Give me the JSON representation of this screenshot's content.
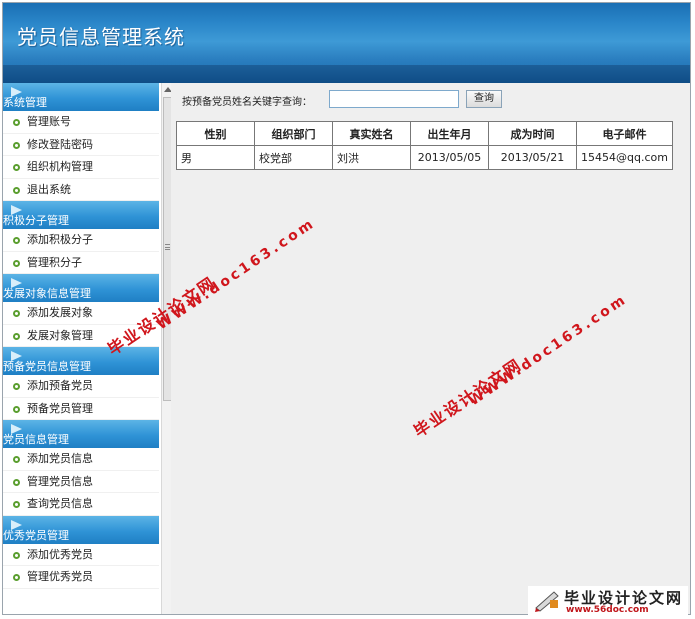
{
  "header": {
    "title": "党员信息管理系统"
  },
  "sidebar": {
    "sections": [
      {
        "title": "系统管理",
        "items": [
          "管理账号",
          "修改登陆密码",
          "组织机构管理",
          "退出系统"
        ]
      },
      {
        "title": "积极分子管理",
        "items": [
          "添加积极分子",
          "管理积分子"
        ]
      },
      {
        "title": "发展对象信息管理",
        "items": [
          "添加发展对象",
          "发展对象管理"
        ]
      },
      {
        "title": "预备党员信息管理",
        "items": [
          "添加预备党员",
          "预备党员管理"
        ]
      },
      {
        "title": "党员信息管理",
        "items": [
          "添加党员信息",
          "管理党员信息",
          "查询党员信息"
        ]
      },
      {
        "title": "优秀党员管理",
        "items": [
          "添加优秀党员",
          "管理优秀党员"
        ]
      }
    ]
  },
  "search": {
    "label": "按预备党员姓名关键字查询：",
    "value": "",
    "button": "查询"
  },
  "table": {
    "headers": [
      "性别",
      "组织部门",
      "真实姓名",
      "出生年月",
      "成为时间",
      "电子邮件"
    ],
    "rows": [
      [
        "男",
        "校党部",
        "刘洪",
        "2013/05/05",
        "2013/05/21",
        "15454@qq.com"
      ]
    ]
  },
  "watermarks": {
    "site_a_name": "毕业设计论文网",
    "site_a_url": "WWW.doc163.com",
    "logo_name": "毕业设计论文网",
    "logo_url": "www.56doc.com"
  },
  "colors": {
    "header": "#2a86c9",
    "section": "#2f93d6",
    "accent_watermark": "#d0161c"
  }
}
